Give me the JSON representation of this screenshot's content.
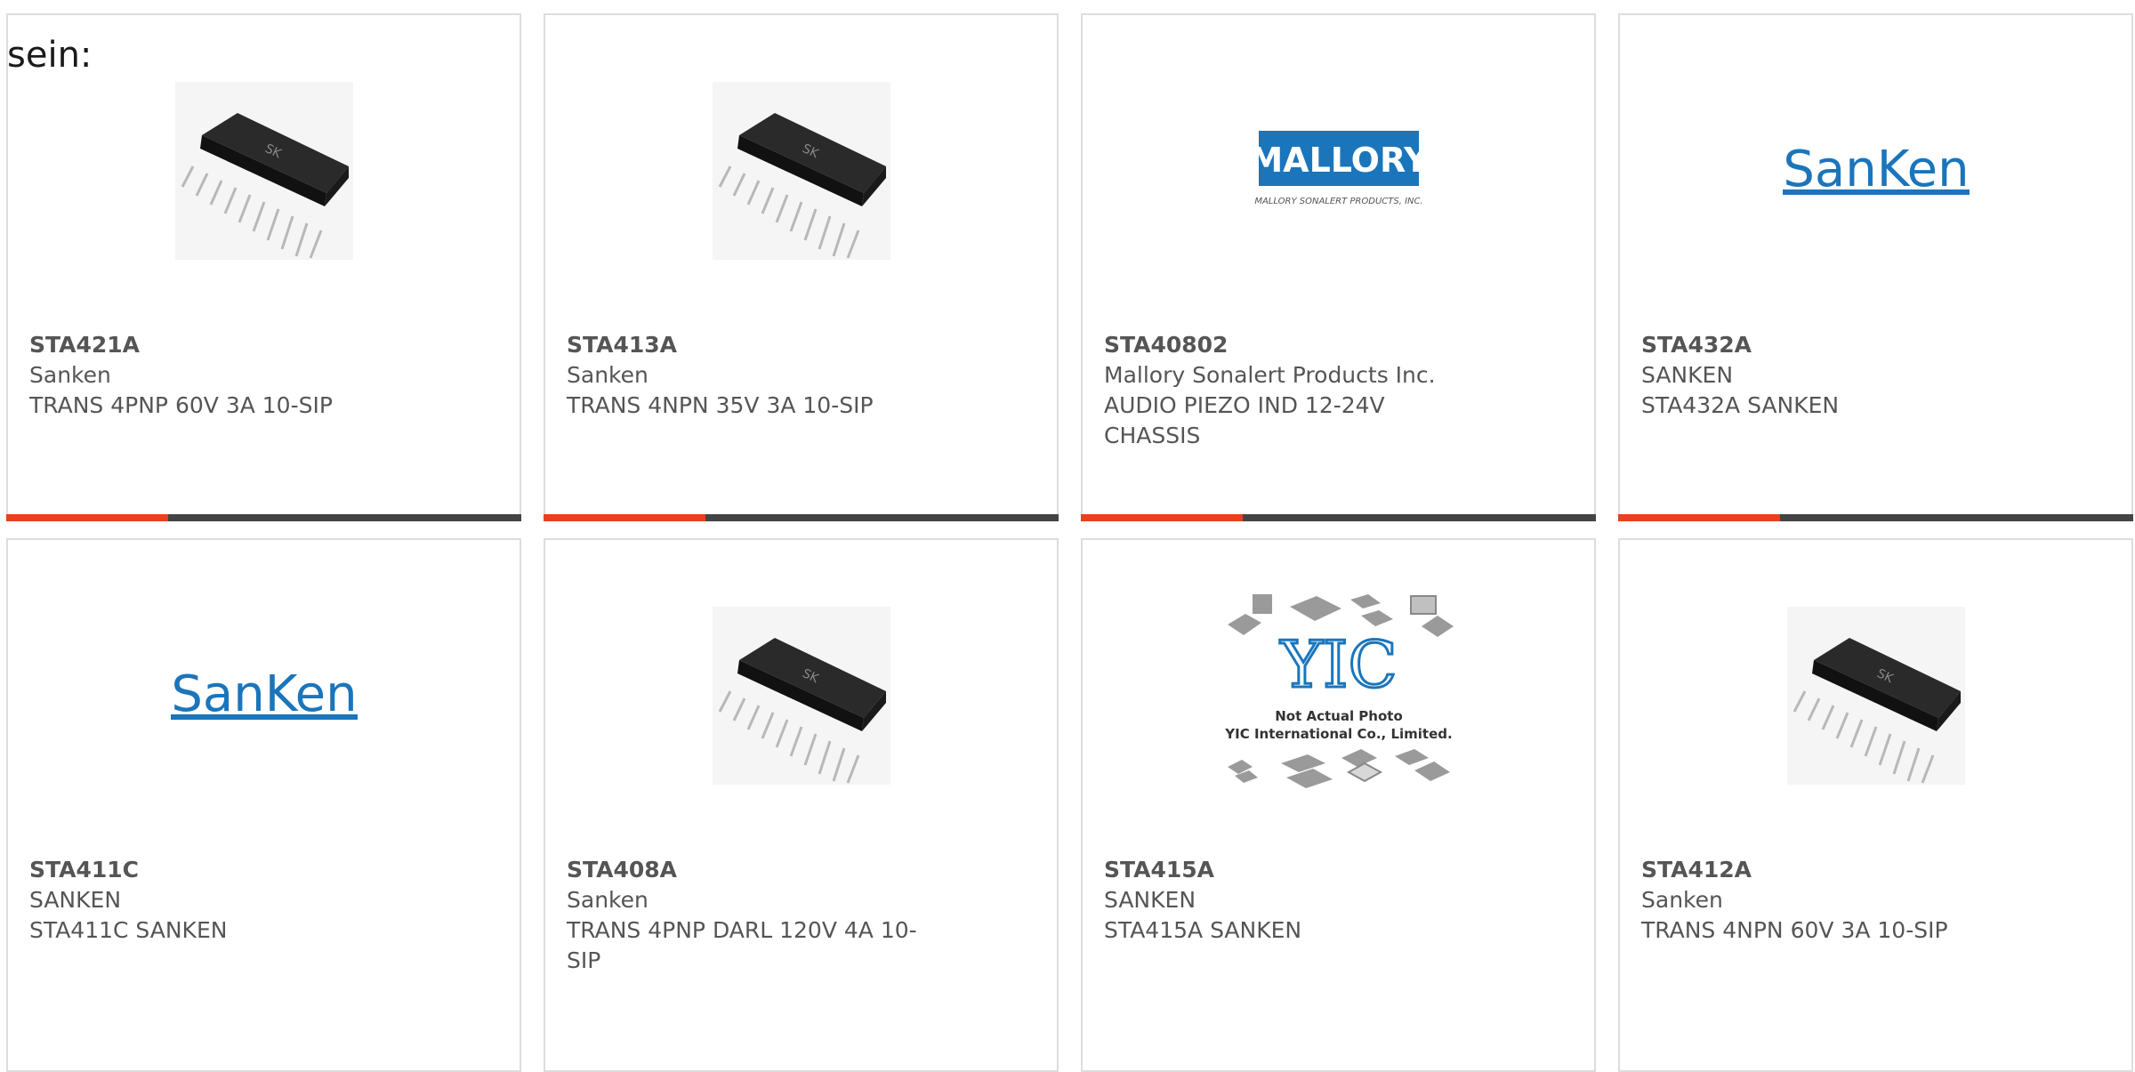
{
  "intro_text": "sein:",
  "colors": {
    "accent": "#e8411b",
    "bar": "#444444",
    "logo_blue": "#1b75bb"
  },
  "products": [
    {
      "part": "STA421A",
      "manufacturer": "Sanken",
      "description": "TRANS 4PNP 60V 3A 10-SIP",
      "image": "sip-chip-photo"
    },
    {
      "part": "STA413A",
      "manufacturer": "Sanken",
      "description": "TRANS 4NPN 35V 3A 10-SIP",
      "image": "sip-chip-photo"
    },
    {
      "part": "STA40802",
      "manufacturer": "Mallory Sonalert Products Inc.",
      "description": "AUDIO PIEZO IND 12-24V CHASSIS",
      "image": "mallory-logo",
      "logo_title": "MALLORY",
      "logo_subtitle": "MALLORY SONALERT PRODUCTS, INC."
    },
    {
      "part": "STA432A",
      "manufacturer": "SANKEN",
      "description": "STA432A SANKEN",
      "image": "sanken-logo",
      "logo_text": "SanKen"
    },
    {
      "part": "STA411C",
      "manufacturer": "SANKEN",
      "description": "STA411C SANKEN",
      "image": "sanken-logo",
      "logo_text": "SanKen"
    },
    {
      "part": "STA408A",
      "manufacturer": "Sanken",
      "description": "TRANS 4PNP DARL 120V 4A 10-SIP",
      "image": "sip-chip-photo"
    },
    {
      "part": "STA415A",
      "manufacturer": "SANKEN",
      "description": "STA415A SANKEN",
      "image": "yic-placeholder",
      "logo_text": "YIC",
      "note_line1": "Not Actual Photo",
      "note_line2": "YIC International Co., Limited."
    },
    {
      "part": "STA412A",
      "manufacturer": "Sanken",
      "description": "TRANS 4NPN 60V 3A 10-SIP",
      "image": "sip-chip-photo"
    }
  ]
}
